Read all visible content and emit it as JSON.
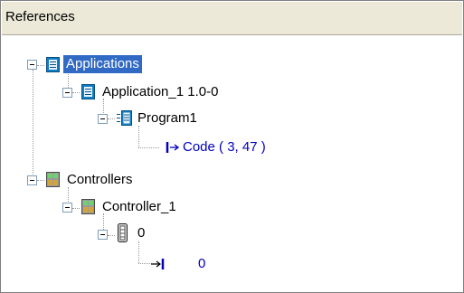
{
  "panel": {
    "header": "References"
  },
  "tree": {
    "applications": {
      "label": "Applications",
      "icon": "document-icon",
      "selected": true,
      "application_1": {
        "label": "Application_1 1.0-0",
        "icon": "document-icon",
        "program1": {
          "label": "Program1",
          "icon": "program-icon",
          "code": {
            "label": "Code ( 3, 47 )",
            "icon": "code-pointer-icon"
          }
        }
      }
    },
    "controllers": {
      "label": "Controllers",
      "icon": "controller-icon",
      "controller_1": {
        "label": "Controller_1",
        "icon": "controller-icon",
        "slot_0": {
          "label": "0",
          "icon": "module-icon",
          "item_0": {
            "label": "0",
            "icon": "io-arrow-icon"
          }
        }
      }
    }
  },
  "colors": {
    "selection": "#316ac5",
    "link_text": "#0000c0",
    "header_bg": "#ece9d8"
  }
}
